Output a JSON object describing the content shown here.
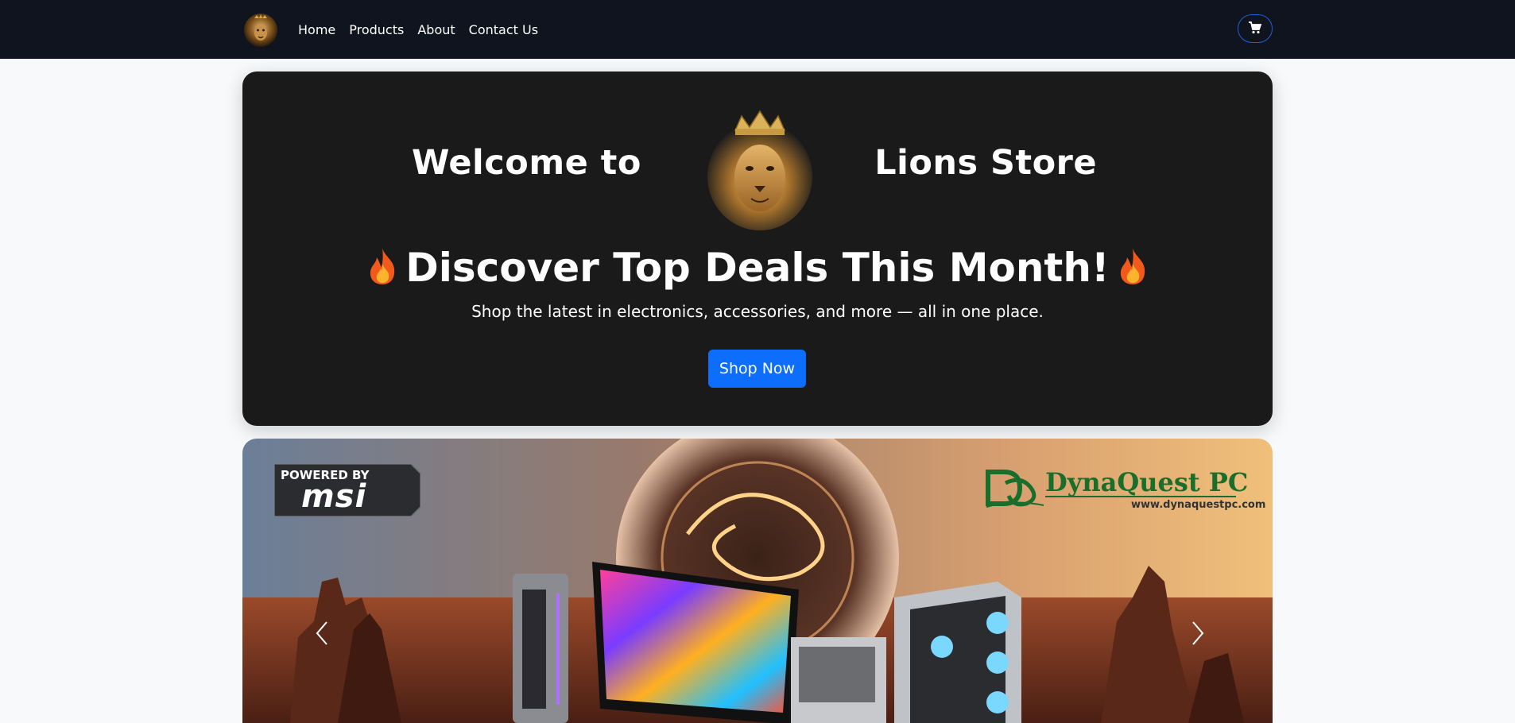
{
  "nav": {
    "logo_icon": "lion-logo-icon",
    "links": [
      "Home",
      "Products",
      "About",
      "Contact Us"
    ],
    "cart_icon": "cart-icon"
  },
  "hero": {
    "welcome": "Welcome to",
    "store": "Lions Store",
    "lion_icon": "lion-crown-icon",
    "title": "Discover Top Deals This Month!",
    "flame_icon": "fire-icon",
    "subtitle": "Shop the latest in electronics, accessories, and more — all in one place.",
    "cta": "Shop Now"
  },
  "carousel": {
    "badge_top": "POWERED BY",
    "badge_brand": "msi",
    "partner_name": "DynaQuest PC",
    "partner_url": "www.dynaquestpc.com",
    "prev_icon": "chevron-left-icon",
    "next_icon": "chevron-right-icon"
  },
  "colors": {
    "nav_bg": "#0f141f",
    "hero_bg": "#1a1a1b",
    "accent": "#0d6efd",
    "partner_green": "#1a6e2b"
  }
}
